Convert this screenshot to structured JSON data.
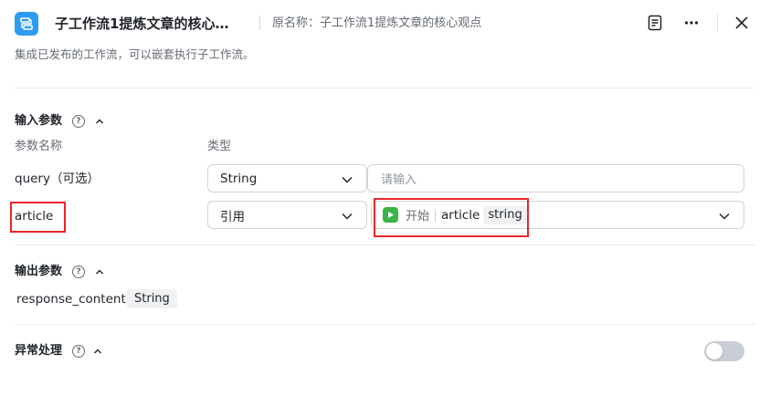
{
  "header": {
    "title": "子工作流1提炼文章的核心…",
    "original_name": "原名称：子工作流1提炼文章的核心观点",
    "app_icon": "workflow-icon",
    "actions": [
      "notes-icon",
      "more-icon",
      "close-icon"
    ]
  },
  "description": "集成已发布的工作流，可以嵌套执行子工作流。",
  "input_section": {
    "title": "输入参数",
    "col_name": "参数名称",
    "col_type": "类型",
    "params": [
      {
        "name": "query（可选）",
        "type": "String",
        "value_placeholder": "请输入"
      },
      {
        "name": "article",
        "type": "引用",
        "ref_node": "开始",
        "ref_var": "article",
        "ref_type": "string"
      }
    ]
  },
  "output_section": {
    "title": "输出参数",
    "outputs": [
      {
        "name": "response_content",
        "type": "String"
      }
    ]
  },
  "error_section": {
    "title": "异常处理",
    "enabled": false
  },
  "colors": {
    "accent_icon": "#2e9bf0",
    "start_node": "#3bb346",
    "highlight": "#e8262a",
    "toggle_off": "#c9cdd4"
  }
}
